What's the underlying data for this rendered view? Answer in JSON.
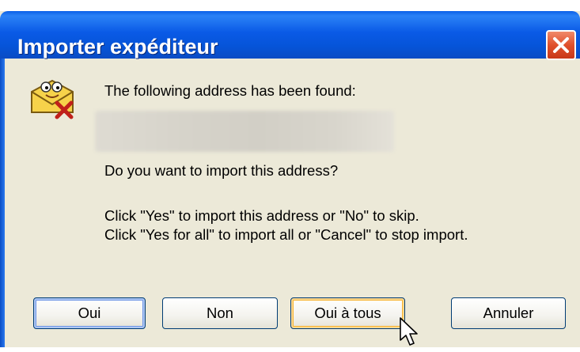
{
  "window": {
    "title": "Importer expéditeur"
  },
  "message": {
    "found_label": "The following address has been found:",
    "question": "Do you want to import this address?",
    "instruction_line1": "Click \"Yes\" to import this address or \"No\" to skip.",
    "instruction_line2": "Click \"Yes for all\" to import all or \"Cancel\" to stop import."
  },
  "buttons": {
    "yes": "Oui",
    "no": "Non",
    "yes_all": "Oui à tous",
    "cancel": "Annuler"
  },
  "icons": {
    "title_close": "close-icon",
    "dialog": "mail-envelope-face-icon",
    "cursor": "mouse-pointer-icon"
  },
  "colors": {
    "titlebar": "#0a5ae6",
    "dialog_bg": "#ece9d8",
    "close_button": "#e0502c"
  }
}
